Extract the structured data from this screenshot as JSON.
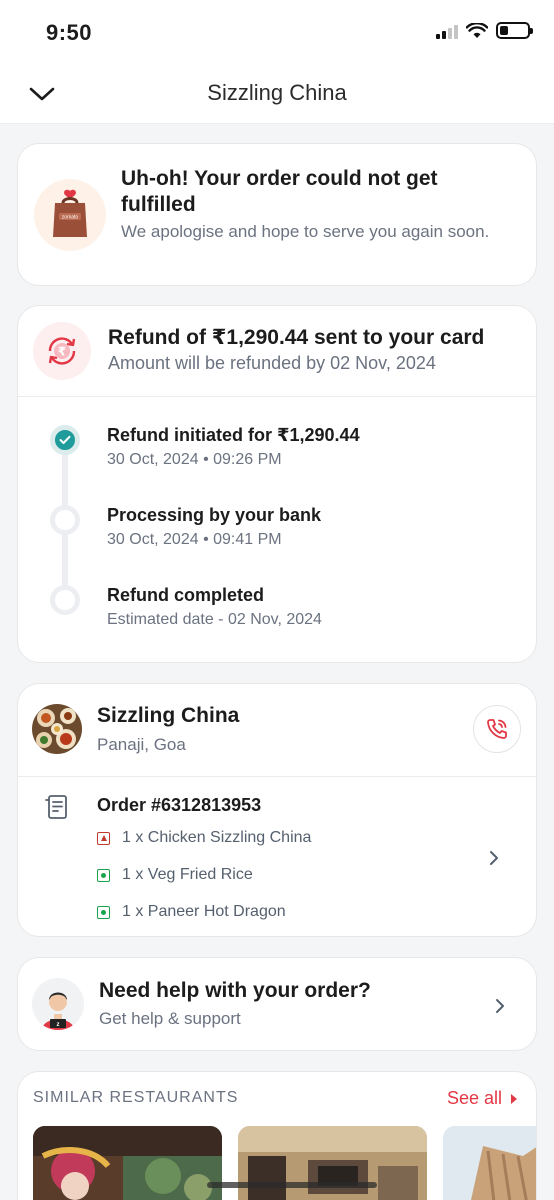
{
  "status_bar": {
    "time": "9:50"
  },
  "header": {
    "title": "Sizzling China"
  },
  "order_status": {
    "title": "Uh-oh! Your order could not get fulfilled",
    "subtitle": "We apologise and hope to serve you again soon.",
    "brand_mark": "zomato"
  },
  "refund": {
    "title": "Refund of ₹1,290.44 sent to your card",
    "subtitle": "Amount will be refunded by 02 Nov, 2024",
    "steps": [
      {
        "title": "Refund initiated for ₹1,290.44",
        "subtitle": "30 Oct, 2024 • 09:26 PM",
        "done": true
      },
      {
        "title": "Processing by your bank",
        "subtitle": "30 Oct, 2024 • 09:41 PM",
        "done": false
      },
      {
        "title": "Refund completed",
        "subtitle": "Estimated date - 02 Nov, 2024",
        "done": false
      }
    ]
  },
  "restaurant": {
    "name": "Sizzling China",
    "location": "Panaji, Goa",
    "order_id": "Order #6312813953",
    "items": [
      {
        "text": "1 x Chicken Sizzling China",
        "type": "non-veg"
      },
      {
        "text": "1 x Veg Fried Rice",
        "type": "veg"
      },
      {
        "text": "1 x Paneer Hot Dragon",
        "type": "veg"
      }
    ]
  },
  "help": {
    "title": "Need help with your order?",
    "subtitle": "Get help & support"
  },
  "similar": {
    "label": "SIMILAR RESTAURANTS",
    "see_all": "See all"
  },
  "colors": {
    "accent": "#e23744",
    "success": "#1f9b9b",
    "veg": "#1aa34a",
    "non_veg": "#c0392b"
  }
}
